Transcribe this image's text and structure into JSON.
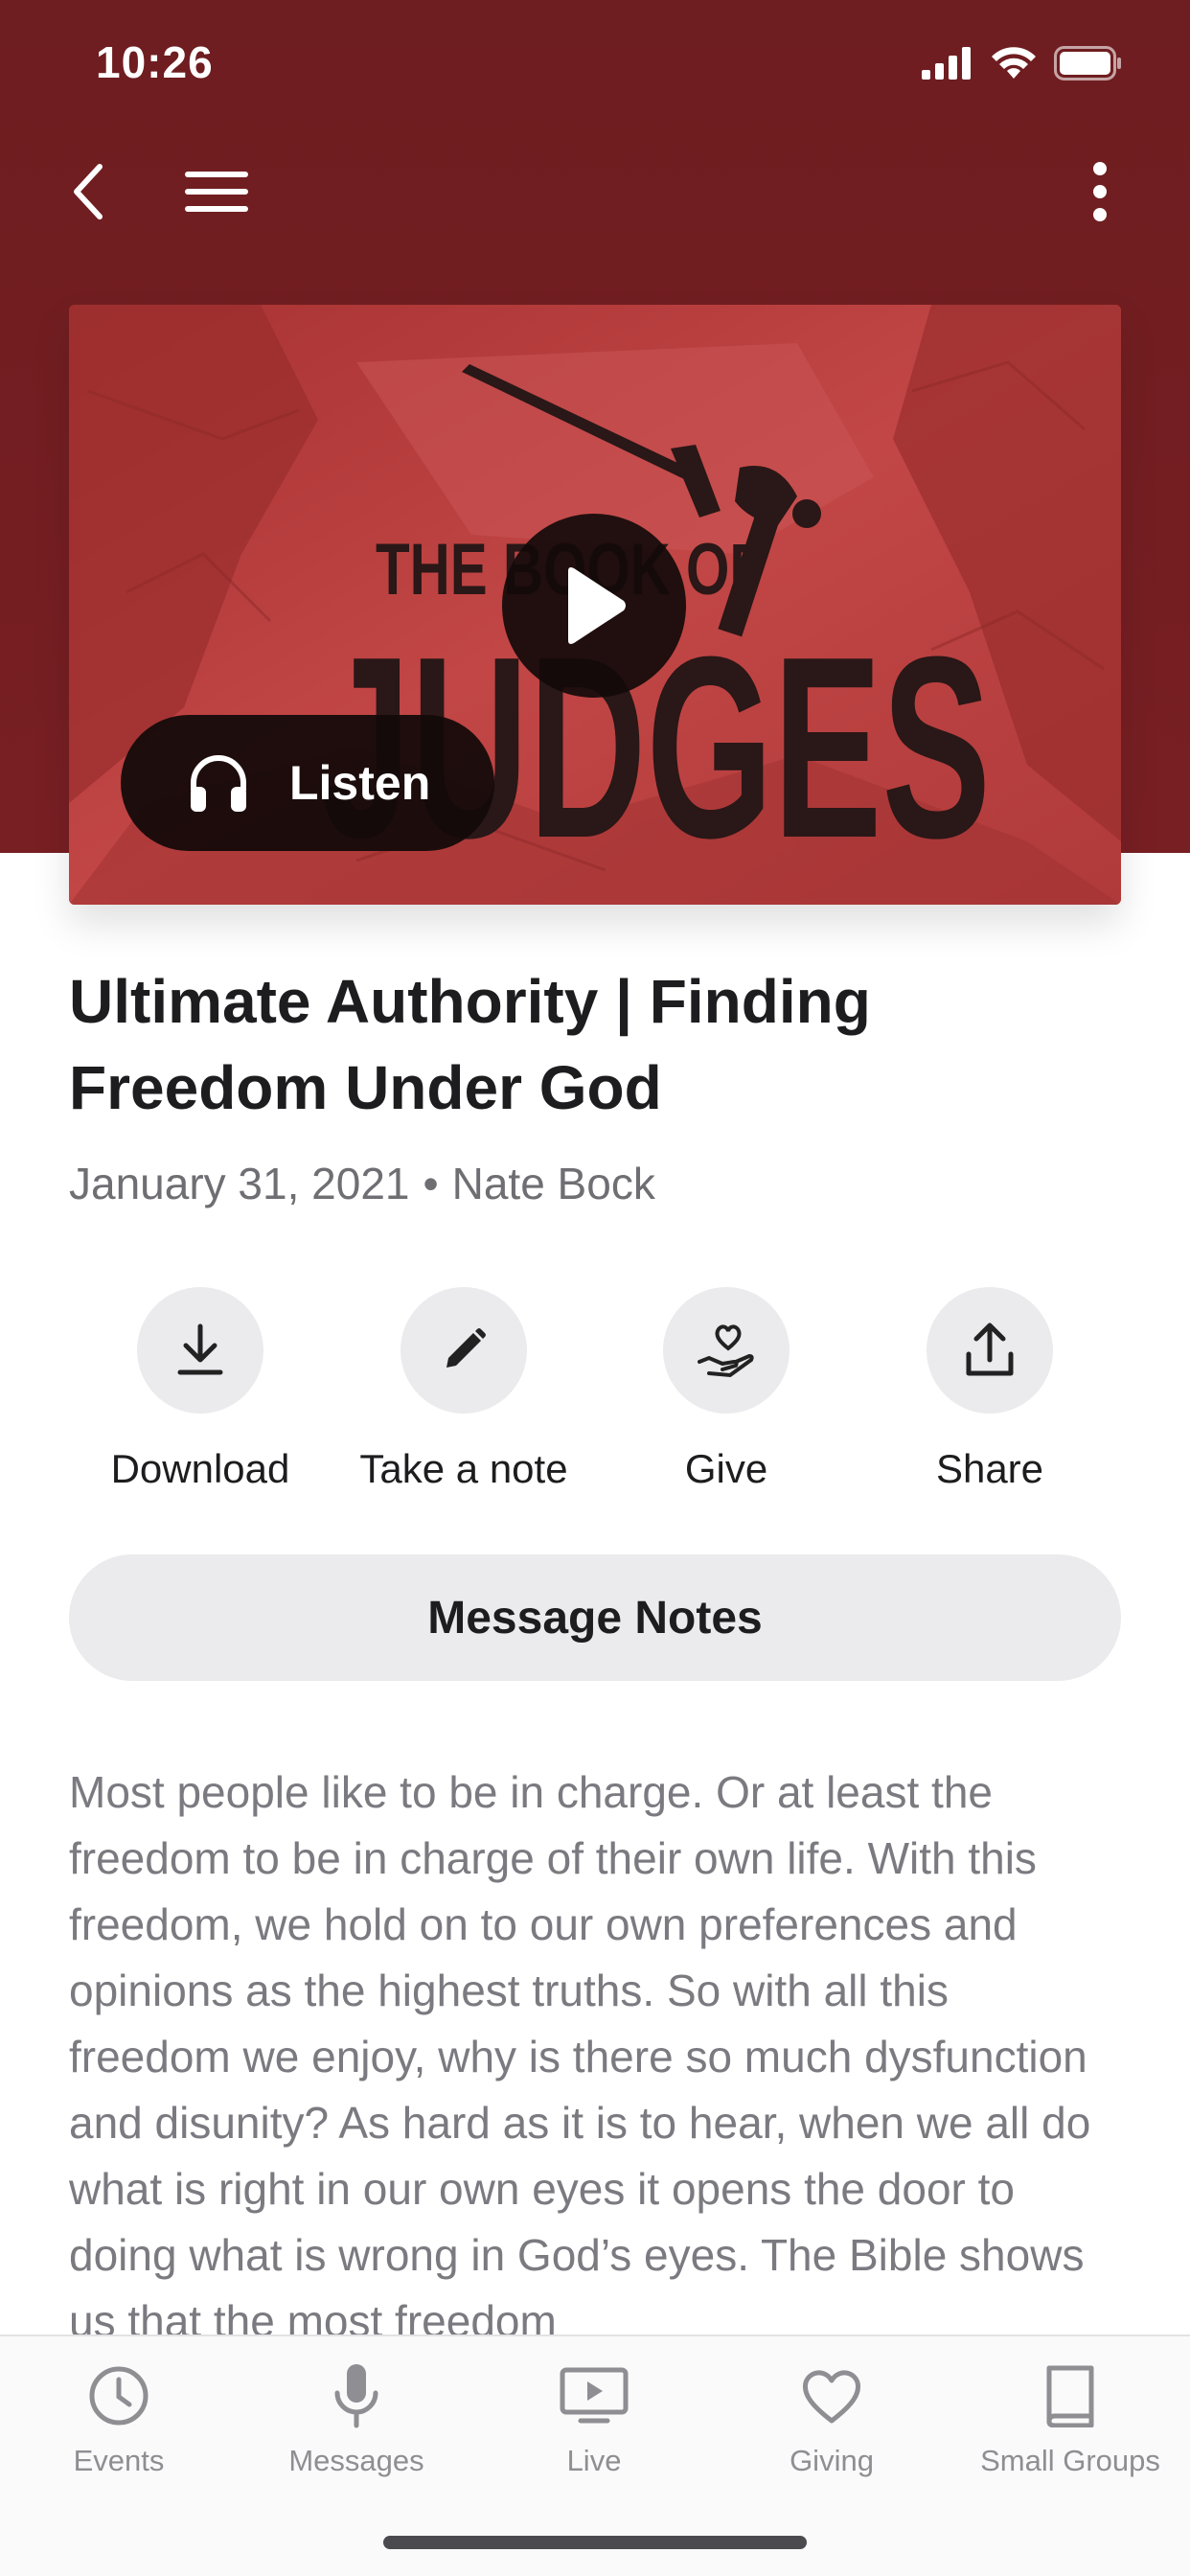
{
  "status_bar": {
    "time": "10:26"
  },
  "colors": {
    "header_bg": "#741e21",
    "hero_tint": "#b83a3a",
    "muted_text": "#7a7a80",
    "tab_inactive": "#8e8e93"
  },
  "nav": {
    "back_icon": "chevron-left-icon",
    "menu_icon": "hamburger-menu-icon",
    "more_icon": "more-vertical-icon"
  },
  "hero": {
    "artwork_lines": [
      "THE BOOK OF",
      "JUDGES"
    ],
    "play_icon": "play-icon",
    "listen_label": "Listen",
    "listen_icon": "headphones-icon"
  },
  "sermon": {
    "title": "Ultimate Authority | Finding Freedom Under God",
    "date": "January 31, 2021",
    "separator": "•",
    "speaker": "Nate Bock"
  },
  "actions": [
    {
      "label": "Download",
      "icon": "download-icon"
    },
    {
      "label": "Take a note",
      "icon": "pencil-icon"
    },
    {
      "label": "Give",
      "icon": "give-heart-hand-icon"
    },
    {
      "label": "Share",
      "icon": "share-icon"
    }
  ],
  "notes_button": "Message Notes",
  "description": "Most people like to be in charge. Or at least the freedom to be in charge of their own life. With this freedom, we hold on to our own preferences and opinions as the highest truths. So with all this freedom we enjoy, why is there so much dysfunction and disunity? As hard as it is to hear, when we all do what is right in our own eyes it opens the door to doing what is wrong in God’s eyes. The Bible shows us that the most freedom",
  "tabs": [
    {
      "label": "Events",
      "icon": "clock-icon"
    },
    {
      "label": "Messages",
      "icon": "microphone-icon"
    },
    {
      "label": "Live",
      "icon": "tv-play-icon"
    },
    {
      "label": "Giving",
      "icon": "heart-icon"
    },
    {
      "label": "Small Groups",
      "icon": "book-icon"
    }
  ]
}
